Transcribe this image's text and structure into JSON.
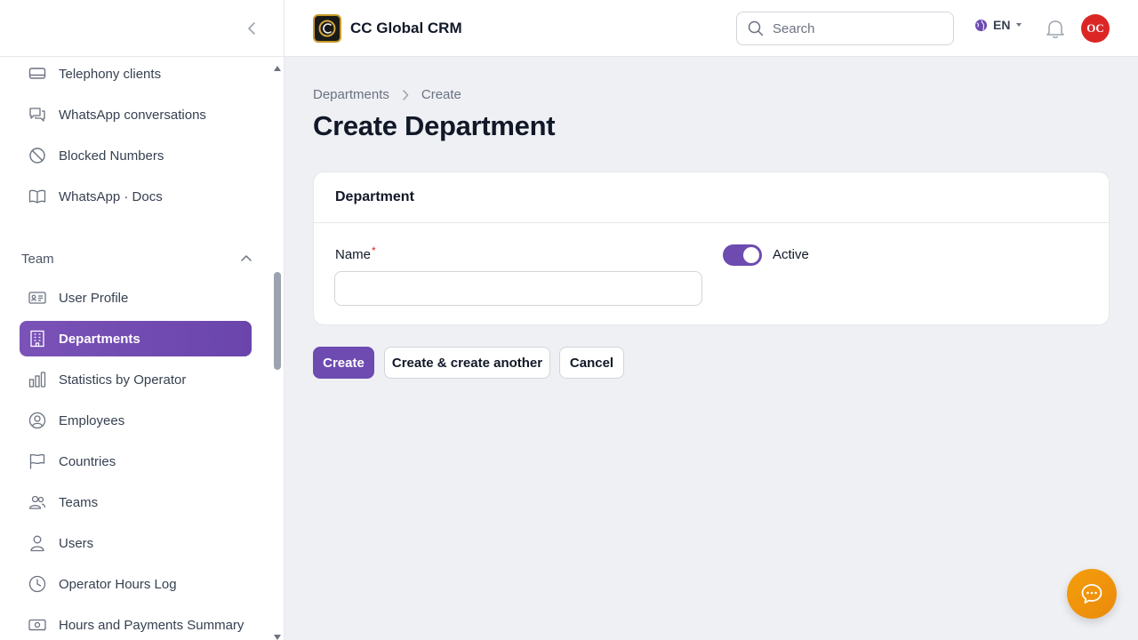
{
  "app": {
    "name": "CC Global CRM"
  },
  "header": {
    "search_placeholder": "Search",
    "language": "EN",
    "avatar_initials": "OC"
  },
  "sidebar": {
    "top_items": [
      {
        "label": "Telephony clients",
        "icon": "monitor-icon"
      },
      {
        "label": "WhatsApp conversations",
        "icon": "chat-bubbles-icon"
      },
      {
        "label": "Blocked Numbers",
        "icon": "ban-icon"
      },
      {
        "label": "WhatsApp · Docs",
        "icon": "book-icon"
      }
    ],
    "group": {
      "label": "Team",
      "expanded": true
    },
    "team_items": [
      {
        "label": "User Profile",
        "icon": "id-card-icon"
      },
      {
        "label": "Departments",
        "icon": "building-icon",
        "active": true
      },
      {
        "label": "Statistics by Operator",
        "icon": "bar-chart-icon"
      },
      {
        "label": "Employees",
        "icon": "user-circle-icon"
      },
      {
        "label": "Countries",
        "icon": "flag-icon"
      },
      {
        "label": "Teams",
        "icon": "users-icon"
      },
      {
        "label": "Users",
        "icon": "user-icon"
      },
      {
        "label": "Operator Hours Log",
        "icon": "clock-icon"
      },
      {
        "label": "Hours and Payments Summary",
        "icon": "cash-icon"
      }
    ]
  },
  "breadcrumb": {
    "parent": "Departments",
    "current": "Create"
  },
  "page": {
    "title": "Create Department"
  },
  "form": {
    "section_title": "Department",
    "name_label": "Name",
    "required_mark": "*",
    "name_value": "",
    "active_label": "Active",
    "active": true
  },
  "actions": {
    "create": "Create",
    "create_another": "Create & create another",
    "cancel": "Cancel"
  },
  "colors": {
    "accent": "#6d4bb0",
    "avatar": "#dc2626",
    "chat_fab": "#f59e0b"
  }
}
